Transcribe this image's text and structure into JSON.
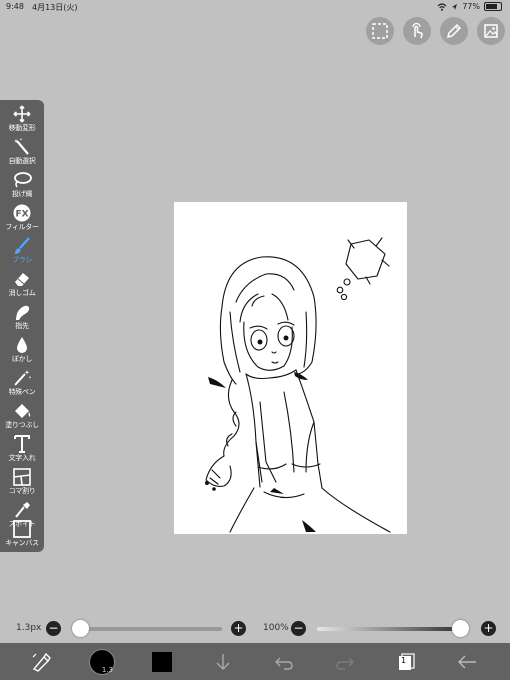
{
  "status": {
    "time": "9:48",
    "date": "4月13日(火)",
    "battery": "77%",
    "battery_level": 0.77
  },
  "topbar": {
    "icons": [
      "selection-icon",
      "gesture-icon",
      "pen-tool-icon",
      "gallery-icon"
    ]
  },
  "tools": [
    {
      "label": "移動変形",
      "icon": "move-icon"
    },
    {
      "label": "自動選択",
      "icon": "magic-wand-icon"
    },
    {
      "label": "投げ縄",
      "icon": "lasso-icon"
    },
    {
      "label": "フィルター",
      "icon": "fx-icon"
    },
    {
      "label": "ブラシ",
      "icon": "brush-icon",
      "active": true
    },
    {
      "label": "消しゴム",
      "icon": "eraser-icon"
    },
    {
      "label": "指先",
      "icon": "finger-icon"
    },
    {
      "label": "ぼかし",
      "icon": "blur-icon"
    },
    {
      "label": "特殊ペン",
      "icon": "special-pen-icon"
    },
    {
      "label": "塗りつぶし",
      "icon": "fill-icon"
    },
    {
      "label": "文字入れ",
      "icon": "text-icon"
    },
    {
      "label": "コマ割り",
      "icon": "frame-icon"
    },
    {
      "label": "スポイト",
      "icon": "eyedropper-icon"
    },
    {
      "label": "キャンバス",
      "icon": "canvas-icon"
    }
  ],
  "brush": {
    "size_label": "1.3px",
    "size_level": 0.0,
    "opacity_label": "100%",
    "opacity_level": 1.0
  },
  "bottom": {
    "brush_size_badge": "1.3",
    "layer_count": "1",
    "current_color": "#000000"
  }
}
